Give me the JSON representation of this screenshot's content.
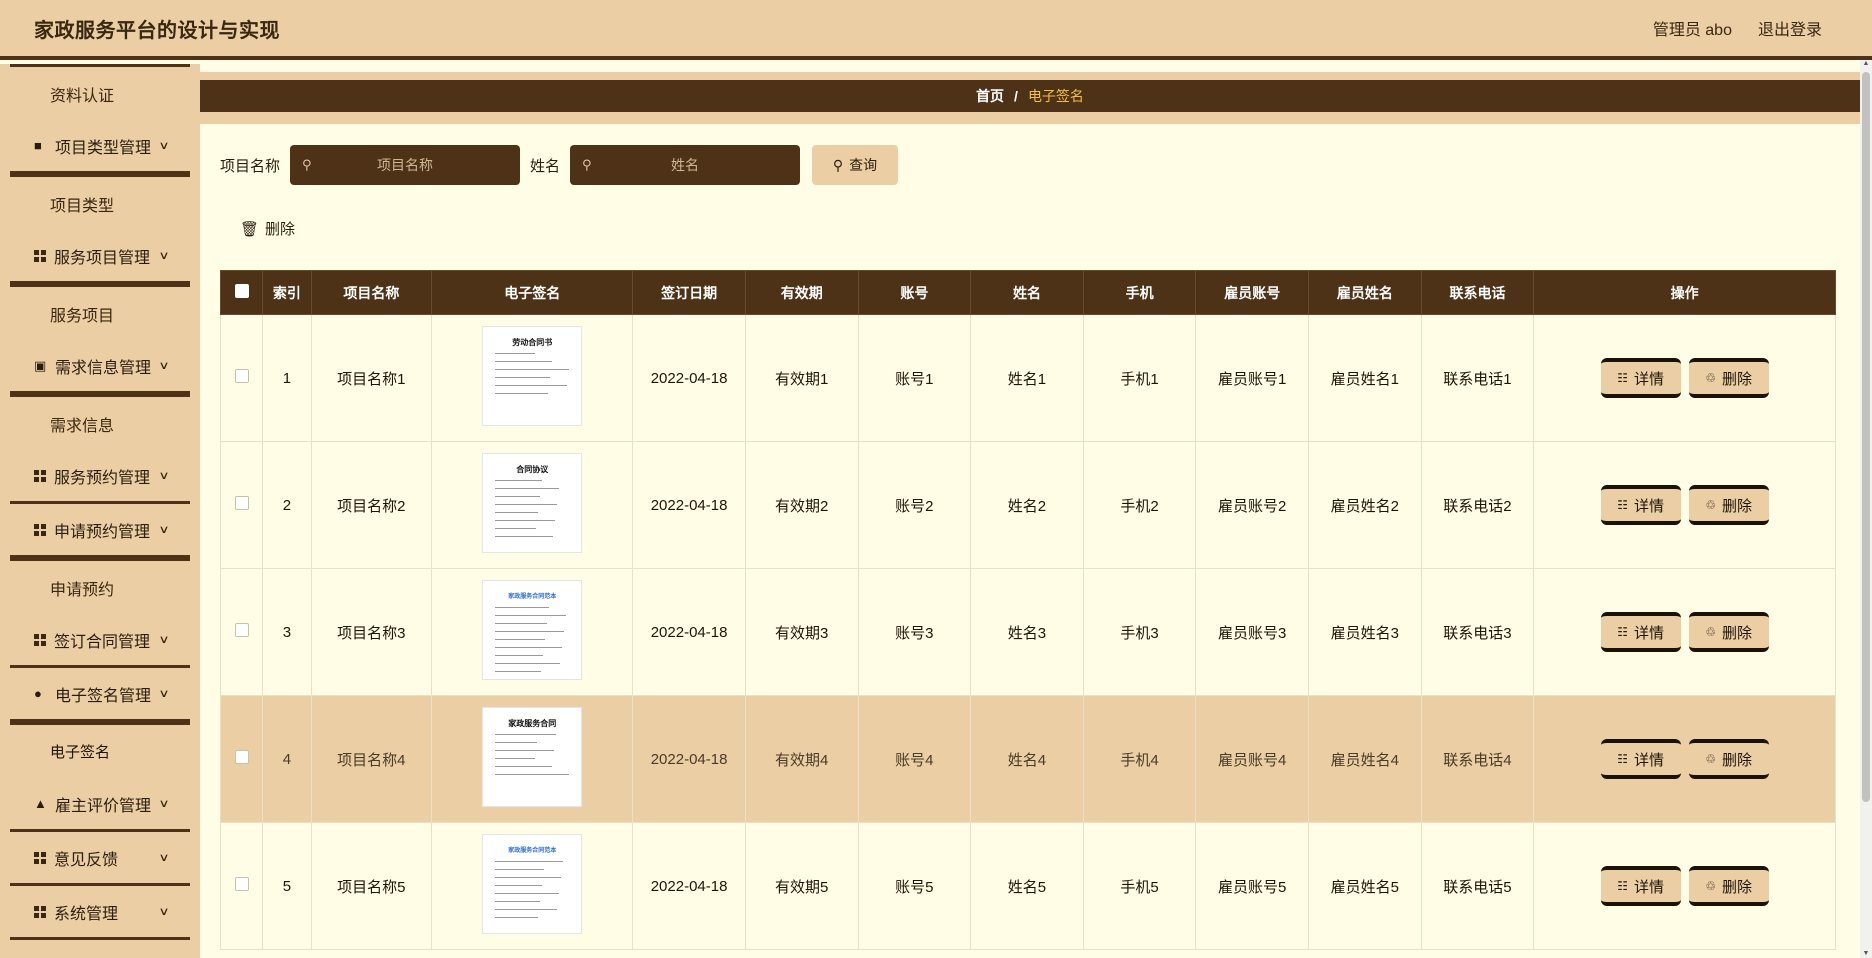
{
  "header": {
    "title": "家政服务平台的设计与实现",
    "user": "管理员 abo",
    "logout": "退出登录"
  },
  "sidebar": {
    "items": [
      {
        "type": "sub",
        "label": "资料认证"
      },
      {
        "type": "menu",
        "label": "项目类型管理",
        "icon": "briefcase-icon"
      },
      {
        "type": "sub",
        "label": "项目类型"
      },
      {
        "type": "menu",
        "label": "服务项目管理",
        "icon": "grid-icon"
      },
      {
        "type": "sub",
        "label": "服务项目"
      },
      {
        "type": "menu",
        "label": "需求信息管理",
        "icon": "clipboard-icon"
      },
      {
        "type": "sub",
        "label": "需求信息"
      },
      {
        "type": "menu",
        "label": "服务预约管理",
        "icon": "grid-icon"
      },
      {
        "type": "menu",
        "label": "申请预约管理",
        "icon": "grid-icon"
      },
      {
        "type": "sub",
        "label": "申请预约"
      },
      {
        "type": "menu",
        "label": "签订合同管理",
        "icon": "grid-icon"
      },
      {
        "type": "menu",
        "label": "电子签名管理",
        "icon": "pin-icon"
      },
      {
        "type": "sub",
        "label": "电子签名",
        "active": true
      },
      {
        "type": "menu",
        "label": "雇主评价管理",
        "icon": "thumb-icon"
      },
      {
        "type": "menu",
        "label": "意见反馈",
        "icon": "grid-icon"
      },
      {
        "type": "menu",
        "label": "系统管理",
        "icon": "grid9-icon"
      }
    ]
  },
  "breadcrumb": {
    "home": "首页",
    "sep": "/",
    "current": "电子签名"
  },
  "search": {
    "project_label": "项目名称",
    "project_placeholder": "项目名称",
    "name_label": "姓名",
    "name_placeholder": "姓名",
    "query_button": "查询"
  },
  "toolbar": {
    "delete_label": "删除"
  },
  "table": {
    "headers": [
      "索引",
      "项目名称",
      "电子签名",
      "签订日期",
      "有效期",
      "账号",
      "姓名",
      "手机",
      "雇员账号",
      "雇员姓名",
      "联系电话",
      "操作"
    ],
    "rows": [
      {
        "index": "1",
        "project": "项目名称1",
        "sign_title": "劳动合同书",
        "date": "2022-04-18",
        "valid": "有效期1",
        "account": "账号1",
        "name": "姓名1",
        "phone": "手机1",
        "emp_account": "雇员账号1",
        "emp_name": "雇员姓名1",
        "contact": "联系电话1"
      },
      {
        "index": "2",
        "project": "项目名称2",
        "sign_title": "合同协议",
        "date": "2022-04-18",
        "valid": "有效期2",
        "account": "账号2",
        "name": "姓名2",
        "phone": "手机2",
        "emp_account": "雇员账号2",
        "emp_name": "雇员姓名2",
        "contact": "联系电话2"
      },
      {
        "index": "3",
        "project": "项目名称3",
        "sign_title": "家政服务合同范本",
        "date": "2022-04-18",
        "valid": "有效期3",
        "account": "账号3",
        "name": "姓名3",
        "phone": "手机3",
        "emp_account": "雇员账号3",
        "emp_name": "雇员姓名3",
        "contact": "联系电话3"
      },
      {
        "index": "4",
        "project": "项目名称4",
        "sign_title": "家政服务合同",
        "date": "2022-04-18",
        "valid": "有效期4",
        "account": "账号4",
        "name": "姓名4",
        "phone": "手机4",
        "emp_account": "雇员账号4",
        "emp_name": "雇员姓名4",
        "contact": "联系电话4"
      },
      {
        "index": "5",
        "project": "项目名称5",
        "sign_title": "家政服务合同范本",
        "date": "2022-04-18",
        "valid": "有效期5",
        "account": "账号5",
        "name": "姓名5",
        "phone": "手机5",
        "emp_account": "雇员账号5",
        "emp_name": "雇员姓名5",
        "contact": "联系电话5"
      }
    ],
    "detail_label": "详情",
    "delete_label": "删除",
    "highlighted_row": 4
  },
  "colors": {
    "primary_dark": "#4e3217",
    "accent_tan": "#ebcea3",
    "background": "#fffde6",
    "breadcrumb_current": "#f2c04a"
  }
}
